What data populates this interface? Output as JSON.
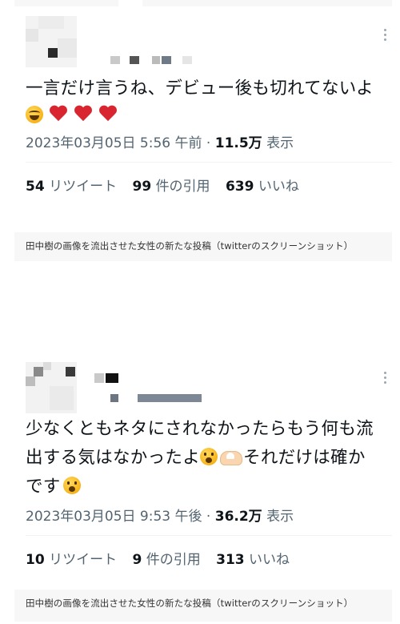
{
  "posts": [
    {
      "text_main": "一言だけ言うね、デビュー後も切れてないよ",
      "emoji_line": [
        "laughing-face",
        "red-heart",
        "red-heart",
        "red-heart"
      ],
      "date": "2023年03月05日 5:56 午前",
      "views_value": "11.5万",
      "views_label": "表示",
      "retweets_count": "54",
      "retweets_label": "リツイート",
      "quotes_count": "99",
      "quotes_label": "件の引用",
      "likes_count": "639",
      "likes_label": "いいね",
      "caption": "田中樹の画像を流出させた女性の新たな投稿（twitterのスクリーンショット）"
    },
    {
      "text_line1": "少なくともネタにされなかったらもう何も流",
      "text_line2": "出する気はなかったよ",
      "text_line2b": "それだけは確か",
      "text_line3": "です",
      "emojis": [
        "astonished-face",
        "heart-hands",
        "astonished-face"
      ],
      "date": "2023年03月05日 9:53 午後",
      "views_value": "36.2万",
      "views_label": "表示",
      "retweets_count": "10",
      "retweets_label": "リツイート",
      "quotes_count": "9",
      "quotes_label": "件の引用",
      "likes_count": "313",
      "likes_label": "いいね",
      "caption": "田中樹の画像を流出させた女性の新たな投稿（twitterのスクリーンショット）"
    }
  ],
  "colors": {
    "text": "#0f1419",
    "muted": "#536471",
    "panel_bg": "#f7f7f7",
    "heart": "#d9252f"
  }
}
